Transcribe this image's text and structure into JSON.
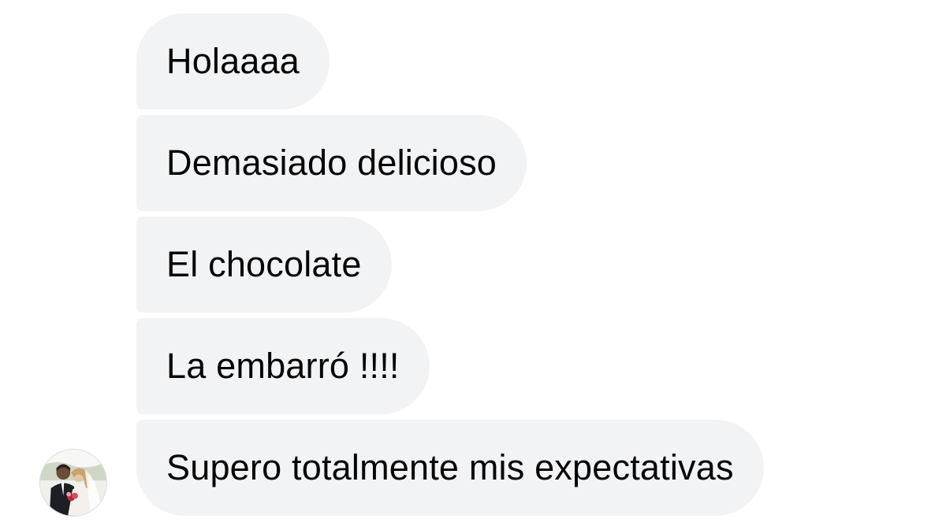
{
  "conversation": {
    "messages": [
      {
        "text": "Holaaaa"
      },
      {
        "text": "Demasiado delicioso"
      },
      {
        "text": "El chocolate"
      },
      {
        "text": "La embarró !!!!"
      },
      {
        "text": "Supero totalmente mis expectativas"
      }
    ],
    "sender": {
      "avatar_icon": "profile-photo-couple"
    }
  },
  "colors": {
    "bubble_background": "#f2f3f5",
    "text": "#050505",
    "page_background": "#ffffff"
  }
}
